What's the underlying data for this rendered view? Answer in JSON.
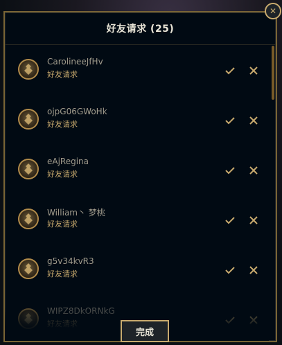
{
  "header": {
    "title": "好友请求 (25)"
  },
  "requests": [
    {
      "name": "CarolineeJfHv",
      "status": "好友请求"
    },
    {
      "name": "ojpG06GWoHk",
      "status": "好友请求"
    },
    {
      "name": "eAjRegina",
      "status": "好友请求"
    },
    {
      "name": "William丶 梦桃",
      "status": "好友请求"
    },
    {
      "name": "g5v34kvR3",
      "status": "好友请求"
    },
    {
      "name": "WIPZ8DkORNkG",
      "status": "好友请求"
    }
  ],
  "footer": {
    "done_label": "完成"
  },
  "colors": {
    "accent": "#c8aa6e",
    "border": "#7a6535",
    "background": "#010a13"
  }
}
